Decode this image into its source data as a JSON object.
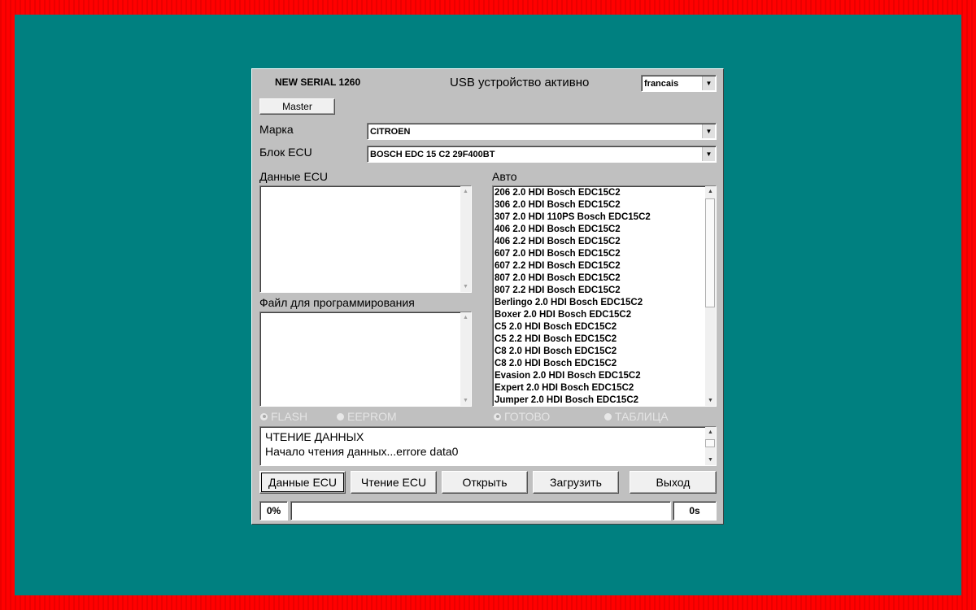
{
  "header": {
    "serial": "NEW SERIAL 1260",
    "usb_status": "USB устройство активно",
    "language": "francais",
    "master_button": "Master"
  },
  "form": {
    "brand_label": "Марка",
    "brand_value": "CITROEN",
    "ecu_label": "Блок ECU",
    "ecu_value": "BOSCH EDC 15 C2 29F400BT"
  },
  "panels": {
    "ecu_data_label": "Данные ECU",
    "program_file_label": "Файл для программирования",
    "auto_label": "Авто"
  },
  "vehicles": [
    "206 2.0 HDI Bosch EDC15C2",
    "306 2.0 HDI Bosch EDC15C2",
    "307 2.0 HDI 110PS Bosch EDC15C2",
    "406 2.0 HDI Bosch EDC15C2",
    "406 2.2 HDI Bosch EDC15C2",
    "607 2.0 HDI Bosch EDC15C2",
    "607 2.2 HDI Bosch EDC15C2",
    "807 2.0 HDI Bosch EDC15C2",
    "807 2.2 HDI Bosch EDC15C2",
    "Berlingo 2.0 HDI Bosch EDC15C2",
    "Boxer 2.0 HDI Bosch EDC15C2",
    "C5 2.0 HDI Bosch EDC15C2",
    "C5 2.2 HDI Bosch EDC15C2",
    "C8 2.0 HDI Bosch EDC15C2",
    "C8 2.0 HDI Bosch EDC15C2",
    "Evasion 2.0 HDI Bosch EDC15C2",
    "Expert 2.0 HDI Bosch EDC15C2",
    "Jumper 2.0 HDI Bosch EDC15C2"
  ],
  "radios": {
    "flash": "FLASH",
    "eeprom": "EEPROM",
    "ready": "ГОТОВО",
    "table": "ТАБЛИЦА"
  },
  "log": {
    "line1": "ЧТЕНИЕ ДАННЫХ",
    "line2": "Начало чтения данных...errore data0"
  },
  "buttons": {
    "ecu_data": "Данные ECU",
    "read_ecu": "Чтение ECU",
    "open": "Открыть",
    "load": "Загрузить",
    "exit": "Выход"
  },
  "progress": {
    "percent_label": "0%",
    "fraction": 0,
    "time_label": "0s"
  },
  "colors": {
    "desktop": "#008080",
    "frame": "#ff0000",
    "window": "#c0c0c0"
  }
}
